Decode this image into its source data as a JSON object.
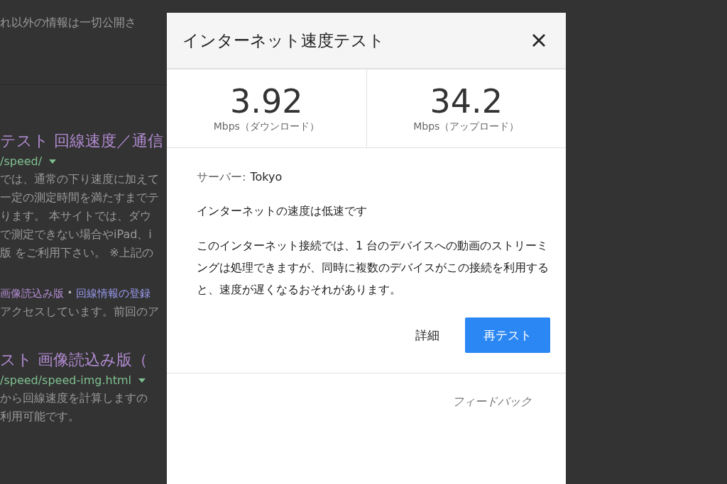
{
  "background_page": {
    "lines": [
      {
        "kind": "text",
        "text": "れ以外の情報は一切公開さ"
      },
      {
        "kind": "divider"
      },
      {
        "kind": "title",
        "text": "テスト 回線速度／通信"
      },
      {
        "kind": "url",
        "text": "/speed/"
      },
      {
        "kind": "text",
        "text": "では、通常の下り速度に加えて"
      },
      {
        "kind": "text",
        "text": "一定の測定時間を満たすまでテ"
      },
      {
        "kind": "text",
        "text": "ります。 本サイトでは、ダウ"
      },
      {
        "kind": "text",
        "text": "で測定できない場合やiPad、i"
      },
      {
        "kind": "text",
        "text": "版 をご利用下さい。 ※上記の"
      },
      {
        "kind": "links",
        "separator": "·",
        "items": [
          "画像読込み版",
          "回線情報の登録"
        ]
      },
      {
        "kind": "text",
        "text": "アクセスしています。前回のア"
      },
      {
        "kind": "title",
        "text": "スト 画像読込み版（"
      },
      {
        "kind": "url",
        "text": "/speed/speed-img.html"
      },
      {
        "kind": "text",
        "text": "から回線速度を計算しますの"
      },
      {
        "kind": "text",
        "text": "利用可能です。"
      }
    ]
  },
  "dialog": {
    "title": "インターネット速度テスト",
    "results": [
      {
        "value": "3.92",
        "label": "Mbps（ダウンロード）"
      },
      {
        "value": "34.2",
        "label": "Mbps（アップロード）"
      }
    ],
    "server_label": "サーバー:",
    "server": "Tokyo",
    "verdict": "インターネットの速度は低速です",
    "description": "このインターネット接続では、1 台のデバイスへの動画のストリーミングは処理できますが、同時に複数のデバイスがこの接続を利用すると、速度が遅くなるおそれがあります。",
    "buttons": [
      {
        "label": "詳細",
        "kind": "text"
      },
      {
        "label": "再テスト",
        "kind": "primary"
      }
    ],
    "feedback": "フィードバック"
  }
}
